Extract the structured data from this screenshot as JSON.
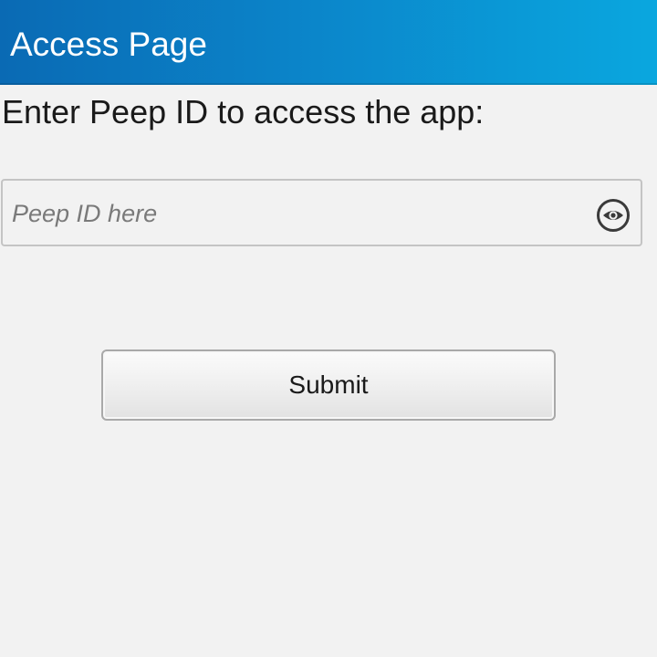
{
  "header": {
    "title": "Access Page",
    "colors": {
      "start": "#0a6ab4",
      "end": "#0aa7df"
    }
  },
  "main": {
    "prompt": "Enter Peep ID to access the app:",
    "peep_id_field": {
      "value": "",
      "placeholder": "Peep ID here",
      "toggle_icon": "eye-icon"
    },
    "submit_label": "Submit"
  }
}
